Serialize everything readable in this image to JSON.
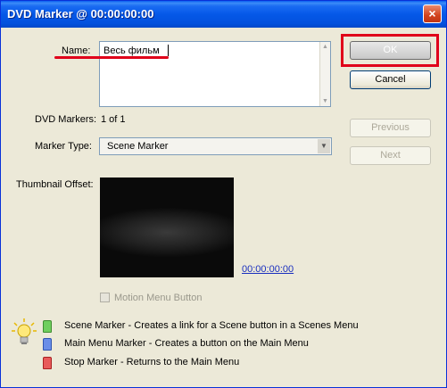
{
  "window": {
    "title": "DVD Marker @ 00:00:00:00",
    "close_glyph": "×"
  },
  "form": {
    "name_label": "Name:",
    "name_value": "Весь фильм",
    "dvd_markers_label": "DVD Markers:",
    "dvd_markers_value": "1 of 1",
    "marker_type_label": "Marker Type:",
    "marker_type_value": "Scene Marker",
    "thumbnail_label": "Thumbnail Offset:",
    "thumbnail_timecode": "00:00:00:00",
    "motion_menu_label": "Motion Menu Button"
  },
  "buttons": {
    "ok": "OK",
    "cancel": "Cancel",
    "previous": "Previous",
    "next": "Next"
  },
  "legend": [
    {
      "icon": "scene-marker-icon",
      "color": "#6fcf5e",
      "text": "Scene Marker - Creates a link for a Scene button in a Scenes Menu"
    },
    {
      "icon": "main-menu-marker-icon",
      "color": "#6a8ee8",
      "text": "Main Menu Marker - Creates a button on the Main Menu"
    },
    {
      "icon": "stop-marker-icon",
      "color": "#e85a5a",
      "text": "Stop Marker - Returns to the Main Menu"
    }
  ],
  "colors": {
    "annotation_red": "#e0001a",
    "title_blue": "#0558e8",
    "link_blue": "#1a2fbf"
  }
}
